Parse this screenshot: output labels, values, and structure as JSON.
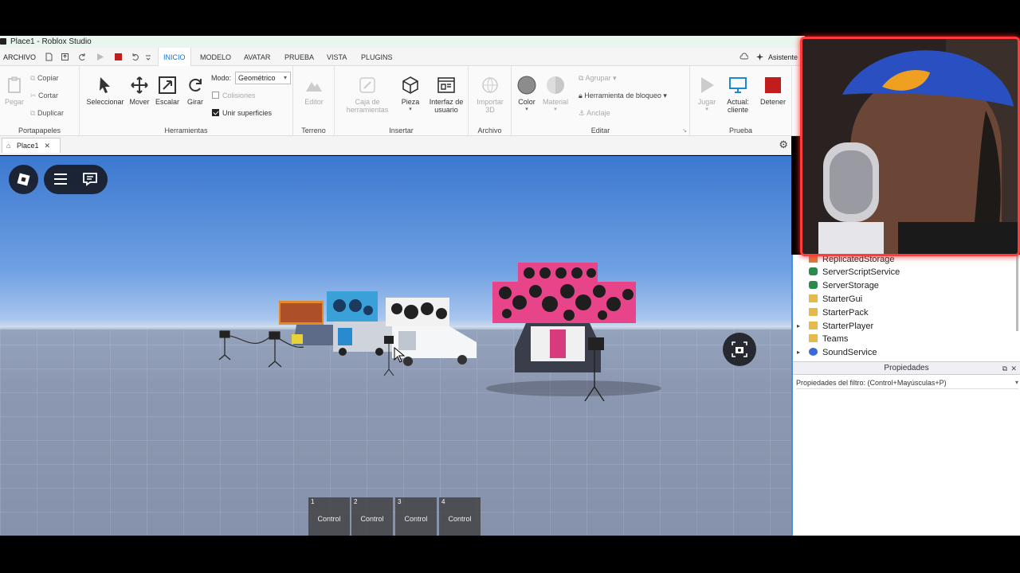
{
  "window": {
    "title": "Place1 - Roblox Studio"
  },
  "menu": {
    "file_label": "ARCHIVO",
    "tabs": [
      "INICIO",
      "MODELO",
      "AVATAR",
      "PRUEBA",
      "VISTA",
      "PLUGINS"
    ],
    "active_tab": "INICIO",
    "assistant_label": "Asistente"
  },
  "ribbon": {
    "clipboard": {
      "paste": "Pegar",
      "copy": "Copiar",
      "cut": "Cortar",
      "duplicate": "Duplicar",
      "group_label": "Portapapeles"
    },
    "tools": {
      "select": "Seleccionar",
      "move": "Mover",
      "scale": "Escalar",
      "rotate": "Girar",
      "mode_label": "Modo:",
      "mode_value": "Geométrico",
      "collisions": "Colisiones",
      "join_surfaces": "Unir superficies",
      "group_label": "Herramientas"
    },
    "terrain": {
      "editor": "Editor",
      "group_label": "Terreno"
    },
    "insert": {
      "toolbox_line1": "Caja de",
      "toolbox_line2": "herramientas",
      "part": "Pieza",
      "ui_line1": "Interfaz de",
      "ui_line2": "usuario",
      "group_label": "Insertar"
    },
    "file": {
      "import_line1": "Importar",
      "import_line2": "3D",
      "group_label": "Archivo"
    },
    "edit": {
      "color": "Color",
      "material": "Material",
      "group": "Agrupar",
      "block_tool": "Herramienta de bloqueo",
      "anchor": "Anclaje",
      "group_label": "Editar"
    },
    "test": {
      "play": "Jugar",
      "current_line1": "Actual:",
      "current_line2": "cliente",
      "stop": "Detener",
      "group_label": "Prueba"
    }
  },
  "doc_tab": {
    "label": "Place1"
  },
  "explorer": {
    "items": [
      {
        "label": "ReplicatedStorage",
        "icon": "storage-icon",
        "expandable": false
      },
      {
        "label": "ServerScriptService",
        "icon": "script-service-icon",
        "expandable": false
      },
      {
        "label": "ServerStorage",
        "icon": "server-storage-icon",
        "expandable": false
      },
      {
        "label": "StarterGui",
        "icon": "folder-icon",
        "expandable": false
      },
      {
        "label": "StarterPack",
        "icon": "folder-icon",
        "expandable": false
      },
      {
        "label": "StarterPlayer",
        "icon": "folder-icon",
        "expandable": true
      },
      {
        "label": "Teams",
        "icon": "teams-icon",
        "expandable": false
      },
      {
        "label": "SoundService",
        "icon": "sound-icon",
        "expandable": true
      }
    ]
  },
  "properties": {
    "title": "Propiedades",
    "filter_placeholder": "Propiedades del filtro: (Control+Mayúsculas+P)"
  },
  "hotbar": [
    {
      "num": "1",
      "label": "Control"
    },
    {
      "num": "2",
      "label": "Control"
    },
    {
      "num": "3",
      "label": "Control"
    },
    {
      "num": "4",
      "label": "Control"
    }
  ],
  "colors": {
    "accent": "#1a6fd1",
    "stop": "#c21d1d",
    "webcam_border": "#ff3b3b"
  }
}
